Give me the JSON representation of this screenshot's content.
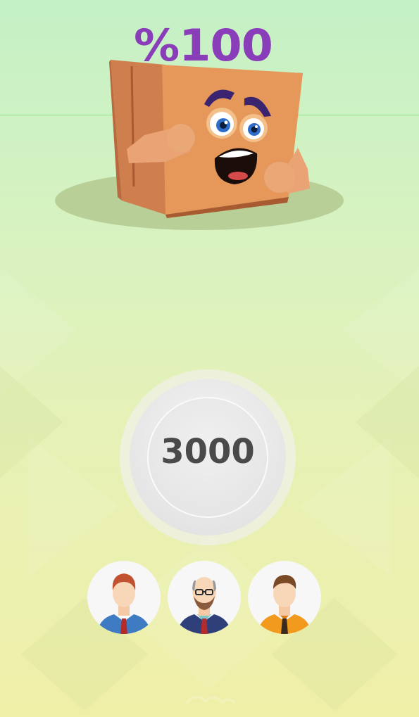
{
  "game": {
    "percent_text": "%100",
    "counter_value": "3000"
  },
  "players": [
    {
      "icon": "businessman-red-tie-icon",
      "suit_color": "#3f7bc3",
      "tie_color": "#b52a2a",
      "hair_color": "#c2522f"
    },
    {
      "icon": "bald-bearded-man-icon",
      "suit_color": "#2f3f7a",
      "tie_color": "#b52a2a",
      "hair_color": "#8a5a3c"
    },
    {
      "icon": "man-orange-shirt-icon",
      "suit_color": "#f29a1d",
      "tie_color": "#3a2a1e",
      "hair_color": "#7a4a26"
    }
  ],
  "colors": {
    "percent": "#8a3db8",
    "counter_text": "#4a4a4a",
    "box": "#e6975a",
    "box_dark": "#b86a38",
    "shadow": "#b9cf98"
  }
}
